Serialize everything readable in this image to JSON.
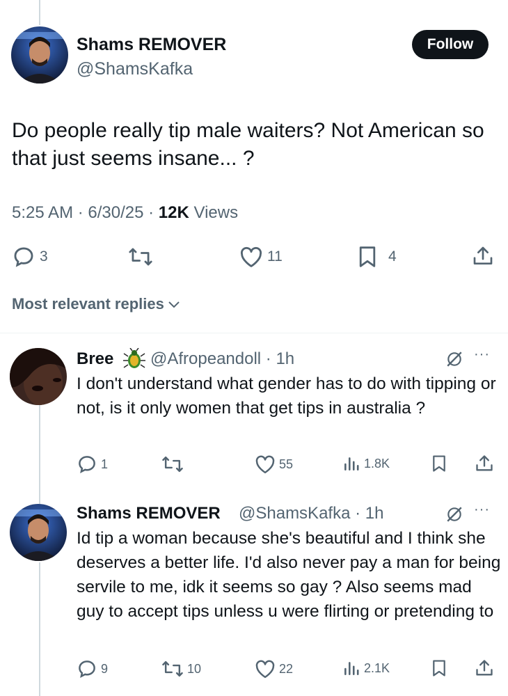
{
  "post": {
    "author_name": "Shams REMOVER",
    "author_handle": "@ShamsKafka",
    "follow_label": "Follow",
    "text": "Do people really tip male waiters? Not American so that just seems insane... ?",
    "time": "5:25 AM · 6/30/25 · ",
    "views_count": "12K",
    "views_label": " Views",
    "stats": {
      "replies": "3",
      "likes": "11",
      "bookmarks": "4"
    }
  },
  "sort": {
    "label": "Most relevant replies"
  },
  "replies": [
    {
      "author_name": "Bree",
      "handle_time": "@Afropeandoll · 1h",
      "text": "I don't understand what gender has to do with tipping or not, is it only women that get tips in australia ?",
      "stats": {
        "replies": "1",
        "retweets": "",
        "likes": "55",
        "views": "1.8K"
      }
    },
    {
      "author_name": "Shams REMOVER",
      "handle_time": "@ShamsKafka · 1h",
      "text": "Id tip a woman because she's beautiful and I think she deserves a better life. I'd also never pay a man for being servile to me, idk it seems so gay ? Also seems mad guy to accept tips unless u were flirting or pretending to",
      "stats": {
        "replies": "9",
        "retweets": "10",
        "likes": "22",
        "views": "2.1K"
      }
    }
  ],
  "colors": {
    "text": "#0f1419",
    "secondary": "#536471",
    "divider": "#eff3f4",
    "thread_line": "#cfd9de",
    "button": "#0f1419"
  },
  "icons": [
    "reply-icon",
    "retweet-icon",
    "like-icon",
    "bookmark-icon",
    "share-icon",
    "views-icon",
    "grok-icon",
    "more-icon",
    "chevron-down-icon",
    "bug-badge-icon"
  ]
}
